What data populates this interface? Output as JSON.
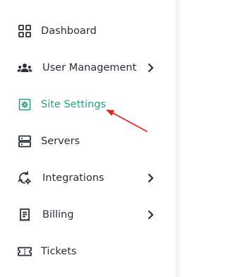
{
  "sidebar": {
    "items": [
      {
        "label": "Dashboard",
        "icon": "grid-icon",
        "active": false,
        "expandable": false
      },
      {
        "label": "User Management",
        "icon": "users-icon",
        "active": false,
        "expandable": true
      },
      {
        "label": "Site Settings",
        "icon": "settings-icon",
        "active": true,
        "expandable": false
      },
      {
        "label": "Servers",
        "icon": "server-icon",
        "active": false,
        "expandable": false
      },
      {
        "label": "Integrations",
        "icon": "integrations-icon",
        "active": false,
        "expandable": true
      },
      {
        "label": "Billing",
        "icon": "receipt-icon",
        "active": false,
        "expandable": true
      },
      {
        "label": "Tickets",
        "icon": "ticket-icon",
        "active": false,
        "expandable": false
      }
    ]
  },
  "colors": {
    "accent": "#2a9d86",
    "text": "#2a2f3a",
    "annotation_arrow": "#e02424"
  }
}
